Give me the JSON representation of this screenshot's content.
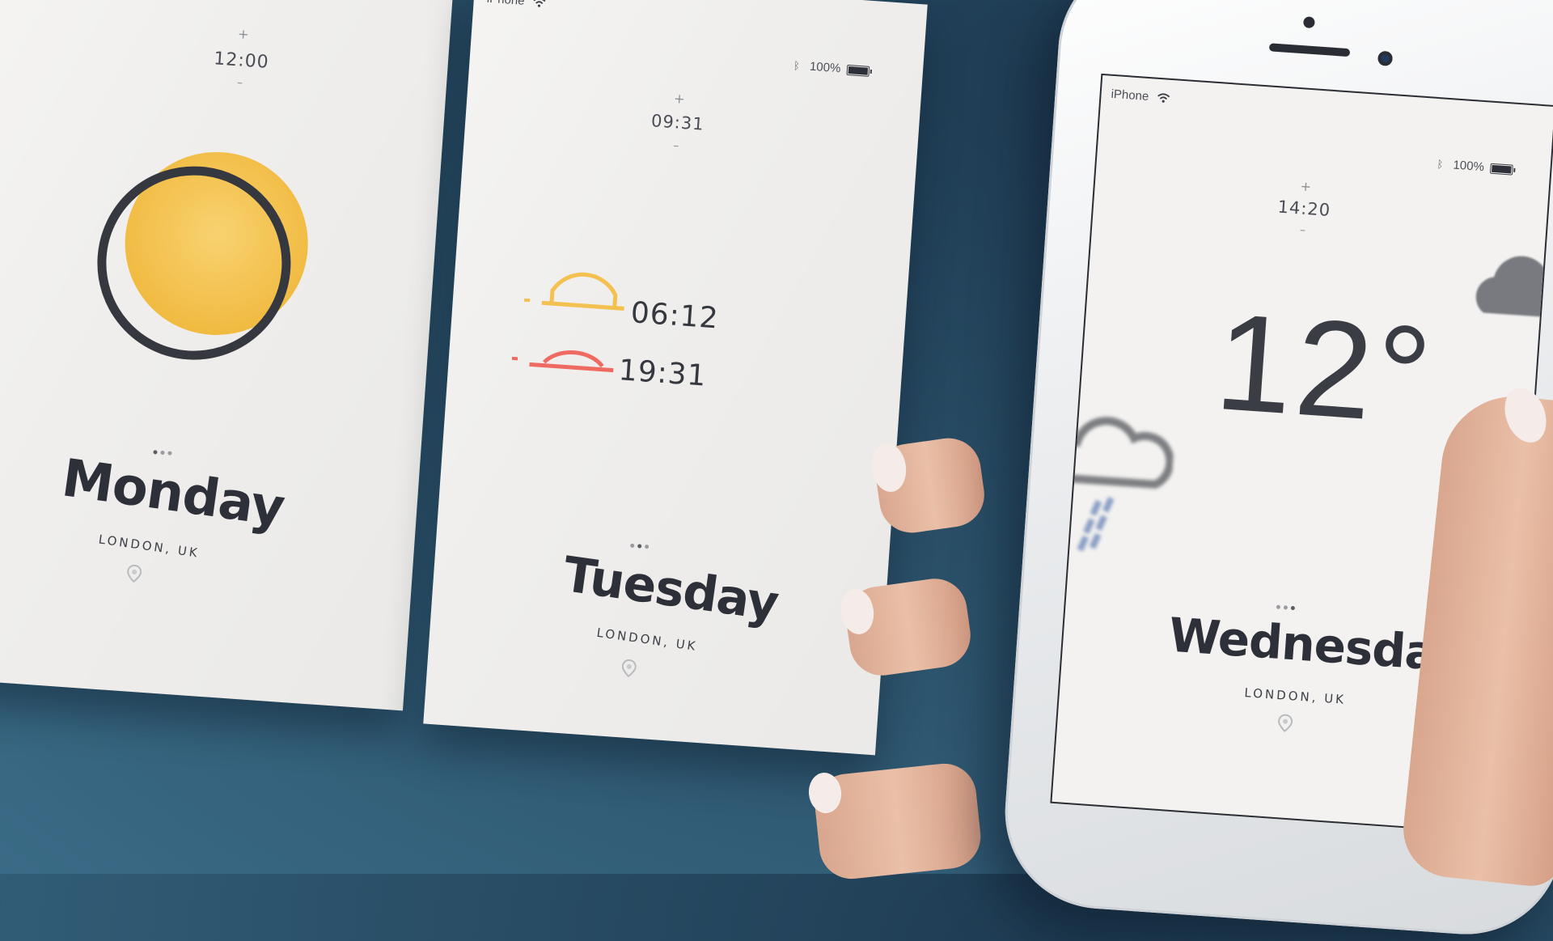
{
  "cards": {
    "monday": {
      "time": "12:00",
      "plus": "+",
      "minus": "–",
      "day": "Monday",
      "location": "LONDON, UK",
      "icon": "sun-icon"
    },
    "tuesday": {
      "carrier": "iPhone",
      "battery": "100%",
      "time": "09:31",
      "plus": "+",
      "minus": "–",
      "sunrise": "06:12",
      "sunset": "19:31",
      "day": "Tuesday",
      "location": "LONDON, UK"
    },
    "wednesday": {
      "carrier": "iPhone",
      "battery": "100%",
      "time": "14:20",
      "plus": "+",
      "minus": "–",
      "temperature": "12°",
      "day": "Wednesday",
      "location": "LONDON, UK",
      "icon": "cloud-rain-icon"
    }
  },
  "colors": {
    "sun": "#f4c04f",
    "sunrise": "#f4c04f",
    "sunset": "#ef6a60",
    "ink": "#2d3038",
    "background": "#2a5068"
  }
}
